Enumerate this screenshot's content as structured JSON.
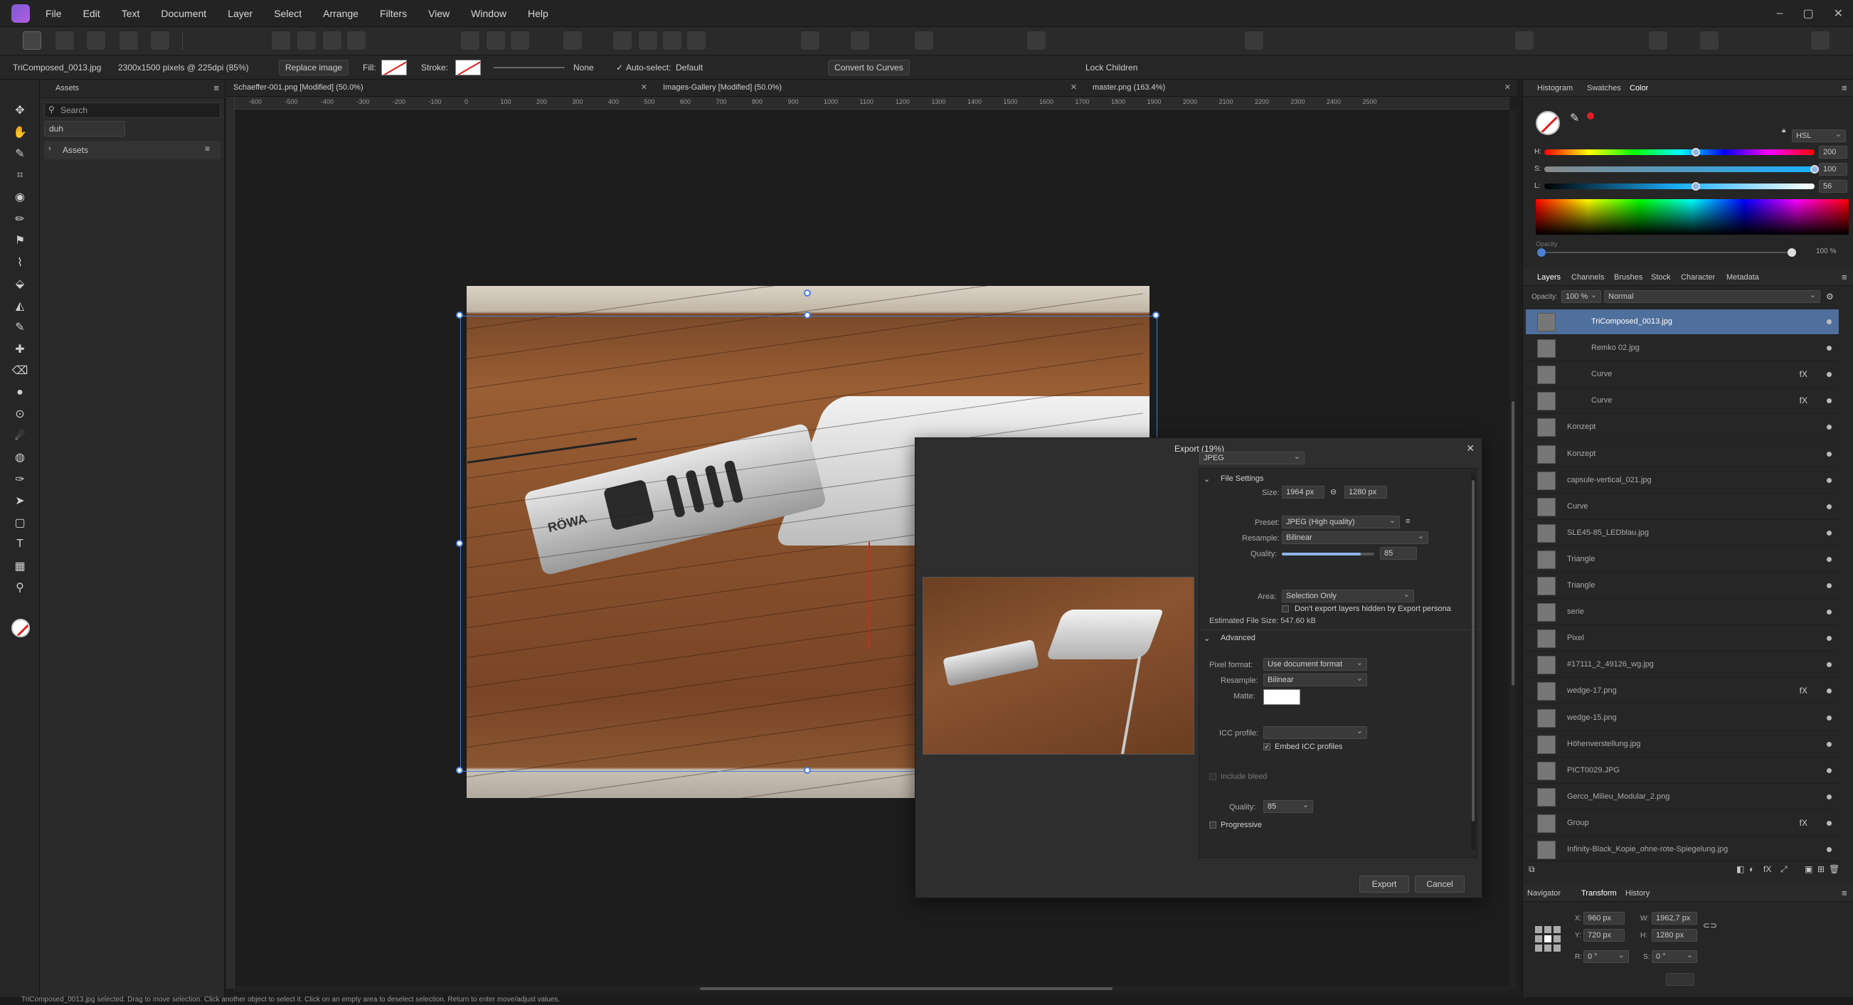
{
  "menu": [
    "File",
    "Edit",
    "Text",
    "Document",
    "Layer",
    "Select",
    "Arrange",
    "Filters",
    "View",
    "Window",
    "Help"
  ],
  "window_controls": [
    "–",
    "▢",
    "✕"
  ],
  "context": {
    "layer_name": "TriComposed_0013.jpg",
    "image_info": "2300x1500 pixels @ 225dpi (85%)",
    "replace_image": "Replace image",
    "fill_label": "Fill:",
    "stroke_label": "Stroke:",
    "stroke_none": "None",
    "auto_select_label": "Auto-select:",
    "auto_select_value": "Default",
    "convert_to_curves": "Convert to Curves",
    "lock_children": "Lock Children"
  },
  "assets": {
    "tab": "Assets",
    "search_placeholder": "Search",
    "category": "duh",
    "group_label": "Assets"
  },
  "doc_tabs": [
    {
      "label": "Schaeffer-001.png [Modified] (50.0%)"
    },
    {
      "label": "Images-Gallery [Modified] (50.0%)"
    },
    {
      "label": "master.png (163.4%)"
    }
  ],
  "ruler_ticks": [
    "-600",
    "-500",
    "-400",
    "-300",
    "-200",
    "-100",
    "0",
    "100",
    "200",
    "300",
    "400",
    "500",
    "600",
    "700",
    "800",
    "900",
    "1000",
    "1100",
    "1200",
    "1300",
    "1400",
    "1500",
    "1600",
    "1700",
    "1800",
    "1900",
    "2000",
    "2100",
    "2200",
    "2300",
    "2400",
    "2500"
  ],
  "export_dialog": {
    "title": "Export (19%)",
    "format": "JPEG",
    "file_settings": "File Settings",
    "size_label": "Size:",
    "width": "1964 px",
    "height": "1280 px",
    "preset_label": "Preset:",
    "preset": "JPEG (High quality)",
    "resample_label": "Resample:",
    "resample": "Bilinear",
    "quality_label": "Quality:",
    "quality": "85",
    "quality_fraction": 0.85,
    "area_label": "Area:",
    "area": "Selection Only",
    "dont_export_hidden": "Don't export layers hidden by Export persona",
    "estimated_size": "Estimated File Size: 547.60 kB",
    "advanced": "Advanced",
    "pixel_format_label": "Pixel format:",
    "pixel_format": "Use document format",
    "resample2_label": "Resample:",
    "resample2": "Bilinear",
    "matte_label": "Matte:",
    "icc_label": "ICC profile:",
    "icc_value": "",
    "embed_icc": "Embed ICC profiles",
    "include_bleed": "Include bleed",
    "quality2_label": "Quality:",
    "quality2": "85",
    "progressive": "Progressive",
    "export_button": "Export",
    "cancel_button": "Cancel"
  },
  "right_panel": {
    "top_tabs": [
      "Histogram",
      "Swatches",
      "Color"
    ],
    "color_model": "HSL",
    "h_label": "H:",
    "h_value": "200",
    "h_fraction": 0.56,
    "s_label": "S:",
    "s_value": "100",
    "s_fraction": 1.0,
    "l_label": "L:",
    "l_value": "56",
    "l_fraction": 0.56,
    "opacity_label": "Opacity",
    "opacity_value": "100 %",
    "layer_tabs": [
      "Layers",
      "Channels",
      "Brushes",
      "Stock",
      "Character",
      "Metadata"
    ],
    "layer_opacity_label": "Opacity:",
    "layer_opacity": "100 %",
    "blend_mode": "Normal",
    "bottom_tabs": [
      "Navigator",
      "Transform",
      "History"
    ],
    "transform": {
      "x_label": "X:",
      "x": "960 px",
      "y_label": "Y:",
      "y": "720 px",
      "w_label": "W:",
      "w": "1962,7 px",
      "h_label": "H:",
      "h": "1280 px",
      "r_label": "R:",
      "r": "0 °",
      "s_label": "S:",
      "s": "0 °"
    }
  },
  "layers": [
    {
      "name": "TriComposed_0013.jpg",
      "fx": ""
    },
    {
      "name": "Remko 02.jpg",
      "fx": ""
    },
    {
      "name": "Curve",
      "fx": "fX"
    },
    {
      "name": "Curve",
      "fx": "fX"
    },
    {
      "name": "Konzept",
      "fx": ""
    },
    {
      "name": "Konzept",
      "fx": ""
    },
    {
      "name": "capsule-vertical_021.jpg",
      "fx": ""
    },
    {
      "name": "Curve",
      "fx": ""
    },
    {
      "name": "SLE45-85_LEDblau.jpg",
      "fx": ""
    },
    {
      "name": "Triangle",
      "fx": ""
    },
    {
      "name": "Triangle",
      "fx": ""
    },
    {
      "name": "serie",
      "fx": ""
    },
    {
      "name": "Pixel",
      "fx": ""
    },
    {
      "name": "#17111_2_49126_wg.jpg",
      "fx": ""
    },
    {
      "name": "wedge-17.png",
      "fx": "fX"
    },
    {
      "name": "wedge-15.png",
      "fx": ""
    },
    {
      "name": "Höhenverstellung.jpg",
      "fx": ""
    },
    {
      "name": "PICT0029.JPG",
      "fx": ""
    },
    {
      "name": "Gerco_Milieu_Modular_2.png",
      "fx": ""
    },
    {
      "name": "Group",
      "fx": "fX"
    },
    {
      "name": "Infinity-Black_Kopie_ohne-rote-Spiegelung.jpg",
      "fx": ""
    }
  ],
  "photo": {
    "brand": "RÖWA"
  },
  "status": "TriComposed_0013.jpg selected. Drag to move selection. Click another object to select it. Click on an empty area to deselect selection. Return to enter move/adjust values.",
  "colors": {
    "accent": "#4a7fd4",
    "selected_layer": "#4f6f9c",
    "guide": "#e02020"
  }
}
